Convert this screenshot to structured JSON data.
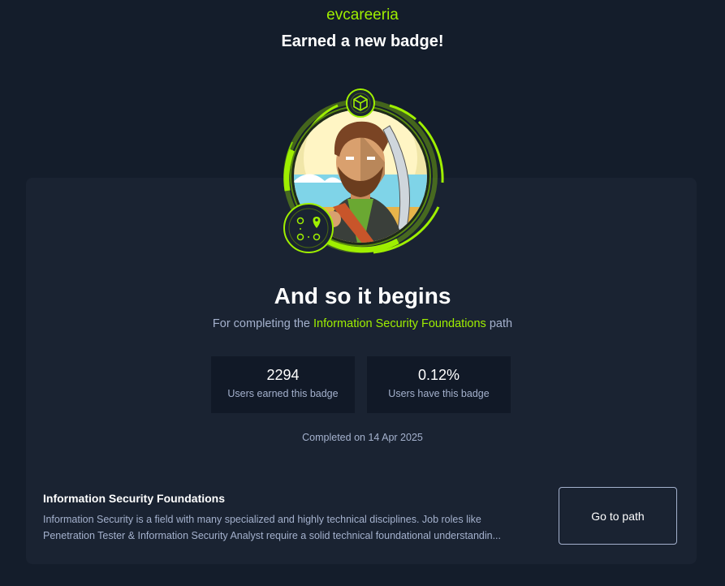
{
  "header": {
    "username": "evcareeria",
    "headline": "Earned a new badge!"
  },
  "badge": {
    "name": "And so it begins",
    "image_icons": [
      "cube-icon",
      "path-map-icon"
    ],
    "subtitle_prefix": "For completing the",
    "subtitle_link": "Information Security Foundations",
    "subtitle_suffix": "path"
  },
  "stats": [
    {
      "value": "2294",
      "label": "Users earned this badge"
    },
    {
      "value": "0.12%",
      "label": "Users have this badge"
    }
  ],
  "completed_text": "Completed on 14 Apr 2025",
  "path": {
    "title": "Information Security Foundations",
    "description_line1": "Information Security is a field with many specialized and highly technical disciplines. Job roles like",
    "description_line2": "Penetration Tester & Information Security Analyst require a solid technical foundational understandin...",
    "button_label": "Go to path"
  },
  "colors": {
    "background": "#141d2b",
    "card": "#1a2332",
    "accent": "#9fef00",
    "muted_text": "#a4b1cd"
  }
}
